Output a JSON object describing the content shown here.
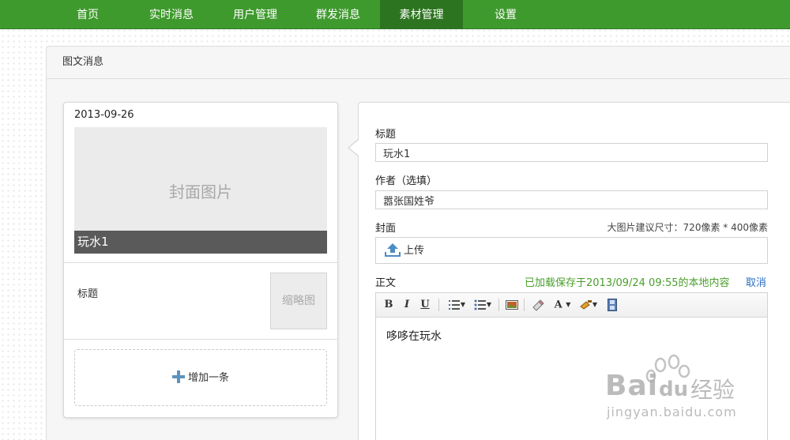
{
  "nav": {
    "items": [
      {
        "label": "首页"
      },
      {
        "label": "实时消息"
      },
      {
        "label": "用户管理"
      },
      {
        "label": "群发消息"
      },
      {
        "label": "素材管理"
      },
      {
        "label": "设置"
      }
    ],
    "active_index": 4
  },
  "panel": {
    "title": "图文消息"
  },
  "preview": {
    "date": "2013-09-26",
    "cover_placeholder": "封面图片",
    "cover_title": "玩水1",
    "sub_title": "标题",
    "thumb_placeholder": "缩略图",
    "add_label": "增加一条"
  },
  "form": {
    "title_label": "标题",
    "title_value": "玩水1",
    "author_label": "作者（选填）",
    "author_value": "嚣张国姓爷",
    "cover_label": "封面",
    "cover_hint": "大图片建议尺寸：720像素 * 400像素",
    "upload_label": "上传",
    "body_label": "正文",
    "saved_notice": "已加载保存于2013/09/24 09:55的本地内容",
    "cancel_label": "取消",
    "body_text": "哆哆在玩水"
  },
  "toolbar": {
    "bold": "B",
    "italic": "I",
    "underline": "U",
    "font_color": "A"
  },
  "watermark": {
    "brand": "Bai",
    "brand2": "du",
    "brand_cn": "经验",
    "url": "jingyan.baidu.com"
  },
  "colors": {
    "nav_bg": "#3f9a2e",
    "nav_active": "#2d7420",
    "saved_green": "#4a9e2a",
    "link_blue": "#2a6ec6"
  }
}
